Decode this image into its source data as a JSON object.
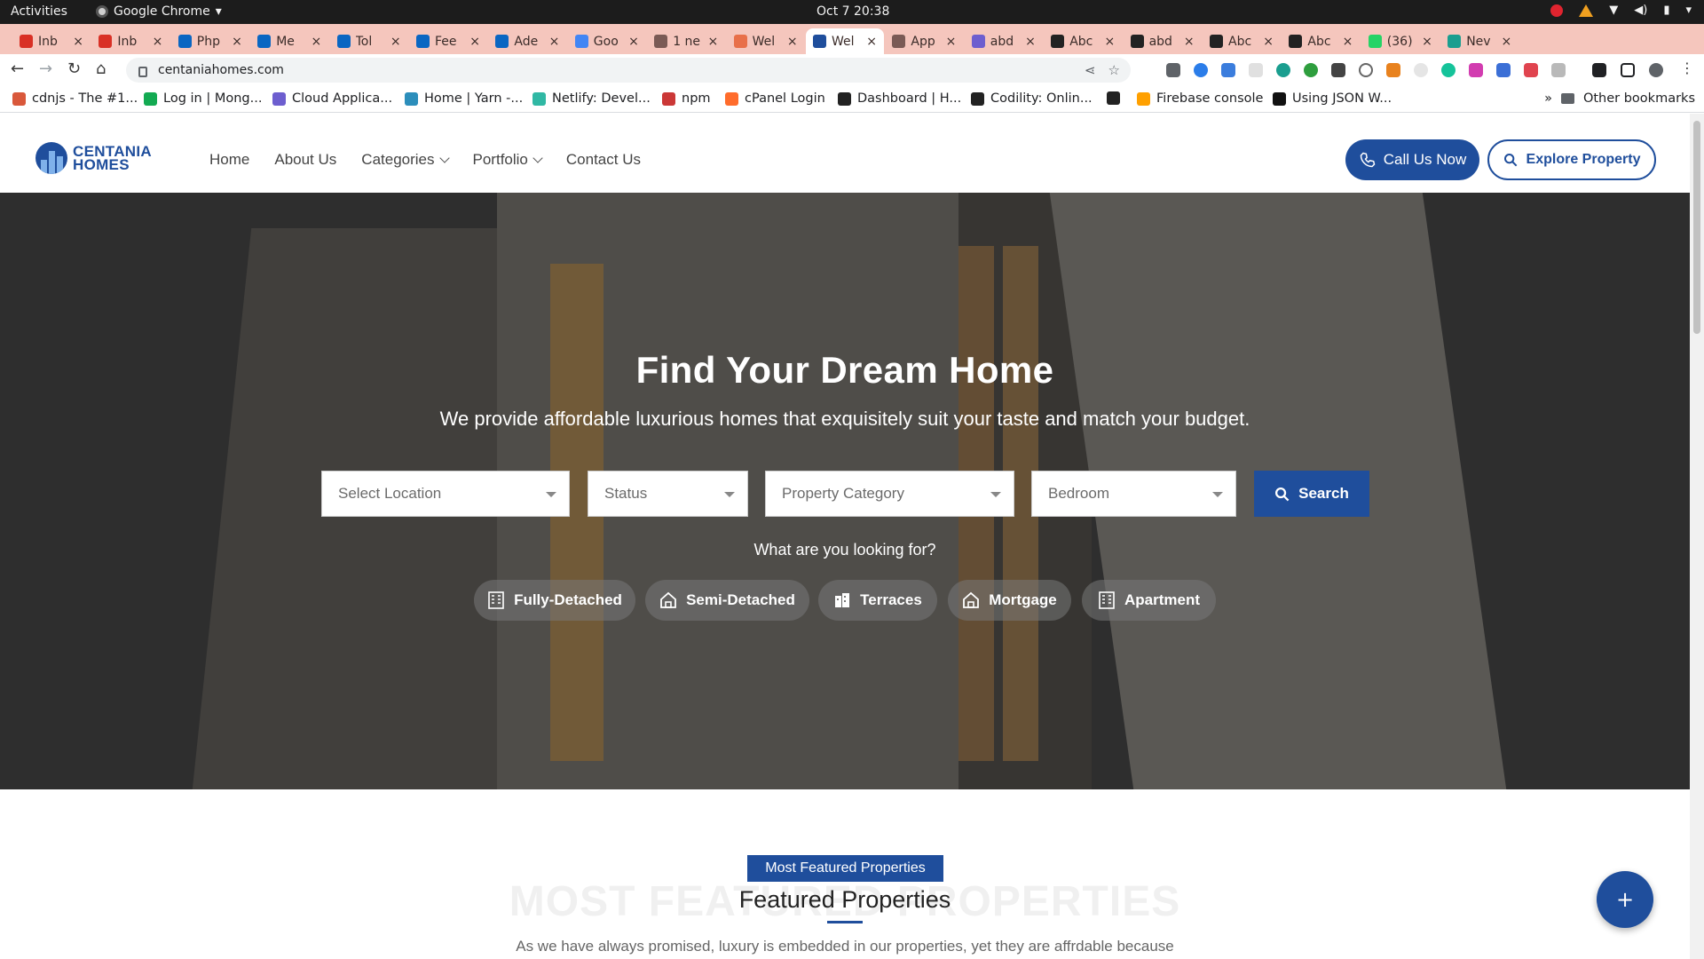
{
  "os_bar": {
    "activities": "Activities",
    "app_name": "Google Chrome",
    "clock": "Oct 7  20:38"
  },
  "browser": {
    "tabs": [
      {
        "title": "Inb",
        "icon": "gmail-icon",
        "color": "#d93025"
      },
      {
        "title": "Inb",
        "icon": "gmail-icon",
        "color": "#d93025"
      },
      {
        "title": "Php",
        "icon": "linkedin-icon",
        "color": "#0a66c2"
      },
      {
        "title": "Me",
        "icon": "linkedin-icon",
        "color": "#0a66c2"
      },
      {
        "title": "Tol",
        "icon": "linkedin-icon",
        "color": "#0a66c2"
      },
      {
        "title": "Fee",
        "icon": "linkedin-icon",
        "color": "#0a66c2"
      },
      {
        "title": "Ade",
        "icon": "linkedin-icon",
        "color": "#0a66c2"
      },
      {
        "title": "Goo",
        "icon": "google-icon",
        "color": "#4285f4"
      },
      {
        "title": "1 ne",
        "icon": "globe-icon",
        "color": "#7a5a55"
      },
      {
        "title": "Wel",
        "icon": "globe-icon",
        "color": "#e8704a"
      },
      {
        "title": "Wel",
        "icon": "centania-icon",
        "color": "#1f4e9c"
      },
      {
        "title": "App",
        "icon": "globe-icon",
        "color": "#7a5a55"
      },
      {
        "title": "abd",
        "icon": "hashnode-icon",
        "color": "#6d5ecf"
      },
      {
        "title": "Abc",
        "icon": "anthropic-icon",
        "color": "#222222"
      },
      {
        "title": "abd",
        "icon": "github-icon",
        "color": "#222222"
      },
      {
        "title": "Abc",
        "icon": "anthropic-icon",
        "color": "#222222"
      },
      {
        "title": "Abc",
        "icon": "anthropic-icon",
        "color": "#222222"
      },
      {
        "title": "(36)",
        "icon": "whatsapp-icon",
        "color": "#25d366"
      },
      {
        "title": "Nev",
        "icon": "meet-icon",
        "color": "#1a9e8f"
      }
    ],
    "url": "centaniahomes.com",
    "bookmarks": [
      {
        "label": "cdnjs - The #1...",
        "color": "#d9583b"
      },
      {
        "label": "Log in | Mong...",
        "color": "#13aa52"
      },
      {
        "label": "Cloud Applica...",
        "color": "#6d5ecf"
      },
      {
        "label": "Home | Yarn -...",
        "color": "#2c8ebb"
      },
      {
        "label": "Netlify: Devel...",
        "color": "#30b8a4"
      },
      {
        "label": "npm",
        "color": "#cb3837"
      },
      {
        "label": "cPanel Login",
        "color": "#ff6c2c"
      },
      {
        "label": "Dashboard | H...",
        "color": "#222222"
      },
      {
        "label": "Codility: Onlin...",
        "color": "#222222"
      },
      {
        "label": "",
        "color": "#222222"
      },
      {
        "label": "Firebase console",
        "color": "#ffa000"
      },
      {
        "label": "Using JSON W...",
        "color": "#111111"
      }
    ],
    "other_bookmarks": "Other bookmarks",
    "more_bookmarks": "»"
  },
  "site": {
    "logo_line1": "CENTANIA",
    "logo_line2": "HOMES",
    "nav": [
      "Home",
      "About Us",
      "Categories",
      "Portfolio",
      "Contact Us"
    ],
    "call_button": "Call Us Now",
    "explore_button": "Explore Property",
    "accent_color": "#1f4e9c"
  },
  "hero": {
    "title": "Find Your Dream Home",
    "subtitle": "We provide affordable luxurious homes that exquisitely suit your taste and match your budget.",
    "filters": {
      "location": "Select Location",
      "status": "Status",
      "category": "Property Category",
      "bedroom": "Bedroom"
    },
    "search_button": "Search",
    "looking_for": "What are you looking for?",
    "chips": [
      "Fully-Detached",
      "Semi-Detached",
      "Terraces",
      "Mortgage",
      "Apartment"
    ]
  },
  "featured": {
    "badge": "Most Featured Properties",
    "ghost_text": "MOST FEATURED PROPERTIES",
    "title": "Featured Properties",
    "description": "As we have always promised, luxury is embedded in our properties, yet they are affrdable because"
  },
  "fab_label": "+"
}
